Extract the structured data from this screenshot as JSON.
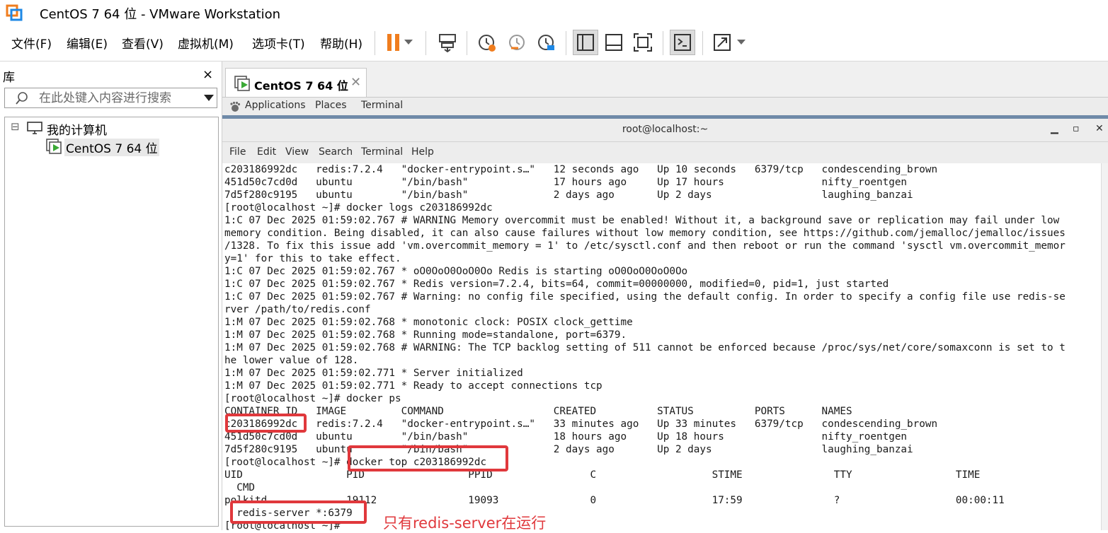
{
  "window": {
    "title": "CentOS 7 64 位 - VMware Workstation"
  },
  "menubar": {
    "items": [
      "文件(F)",
      "编辑(E)",
      "查看(V)",
      "虚拟机(M)",
      "选项卡(T)",
      "帮助(H)"
    ]
  },
  "toolbar": {
    "icons": [
      "pause-icon",
      "dropdown-arrow-icon",
      "send-ctrl-alt-del-icon",
      "snapshot-take-icon",
      "snapshot-revert-icon",
      "snapshot-manager-icon",
      "view-library-icon",
      "view-thumbnail-icon",
      "fullscreen-icon",
      "console-view-icon",
      "stretch-guest-icon",
      "dropdown-arrow-icon"
    ],
    "accent_color": "#f07d1e"
  },
  "library": {
    "header": "库",
    "close": "×",
    "search_placeholder": "在此处键入内容进行搜索",
    "tree": [
      {
        "label": "我的计算机",
        "expander": "⊟"
      },
      {
        "label": "CentOS 7 64 位"
      }
    ]
  },
  "tabs": [
    {
      "label": "CentOS 7 64 位",
      "close": "✕"
    }
  ],
  "gnome_panel": {
    "items": [
      "Applications",
      "Places",
      "Terminal"
    ]
  },
  "terminal_window": {
    "title": "root@localhost:~",
    "controls": [
      "▁",
      "▫",
      "✕"
    ],
    "menu": [
      "File",
      "Edit",
      "View",
      "Search",
      "Terminal",
      "Help"
    ],
    "lines": [
      "c203186992dc   redis:7.2.4   \"docker-entrypoint.s…\"   12 seconds ago   Up 10 seconds   6379/tcp   condescending_brown",
      "451d50c7cd0d   ubuntu        \"/bin/bash\"              17 hours ago     Up 17 hours                nifty_roentgen",
      "7d5f280c9195   ubuntu        \"/bin/bash\"              2 days ago       Up 2 days                  laughing_banzai",
      "[root@localhost ~]# docker logs c203186992dc",
      "1:C 07 Dec 2025 01:59:02.767 # WARNING Memory overcommit must be enabled! Without it, a background save or replication may fail under low",
      "memory condition. Being disabled, it can also cause failures without low memory condition, see https://github.com/jemalloc/jemalloc/issues",
      "/1328. To fix this issue add 'vm.overcommit_memory = 1' to /etc/sysctl.conf and then reboot or run the command 'sysctl vm.overcommit_memor",
      "y=1' for this to take effect.",
      "1:C 07 Dec 2025 01:59:02.767 * oO0OoO0OoO0Oo Redis is starting oO0OoO0OoO0Oo",
      "1:C 07 Dec 2025 01:59:02.767 * Redis version=7.2.4, bits=64, commit=00000000, modified=0, pid=1, just started",
      "1:C 07 Dec 2025 01:59:02.767 # Warning: no config file specified, using the default config. In order to specify a config file use redis-se",
      "rver /path/to/redis.conf",
      "1:M 07 Dec 2025 01:59:02.768 * monotonic clock: POSIX clock_gettime",
      "1:M 07 Dec 2025 01:59:02.768 * Running mode=standalone, port=6379.",
      "1:M 07 Dec 2025 01:59:02.768 # WARNING: The TCP backlog setting of 511 cannot be enforced because /proc/sys/net/core/somaxconn is set to t",
      "he lower value of 128.",
      "1:M 07 Dec 2025 01:59:02.771 * Server initialized",
      "1:M 07 Dec 2025 01:59:02.771 * Ready to accept connections tcp",
      "[root@localhost ~]# docker ps",
      "CONTAINER ID   IMAGE         COMMAND                  CREATED          STATUS          PORTS      NAMES",
      "c203186992dc   redis:7.2.4   \"docker-entrypoint.s…\"   33 minutes ago   Up 33 minutes   6379/tcp   condescending_brown",
      "451d50c7cd0d   ubuntu        \"/bin/bash\"              18 hours ago     Up 18 hours                nifty_roentgen",
      "7d5f280c9195   ubuntu        \"/bin/bash\"              2 days ago       Up 2 days                  laughing_banzai",
      "[root@localhost ~]# docker top c203186992dc",
      "UID                 PID                 PPID                C                   STIME               TTY                 TIME",
      "  CMD",
      "polkitd             19112               19093               0                   17:59               ?                   00:00:11",
      "  redis-server *:6379",
      "[root@localhost ~]# "
    ]
  },
  "annotations": {
    "note": "只有redis-server在运行",
    "color": "#e0383c"
  }
}
